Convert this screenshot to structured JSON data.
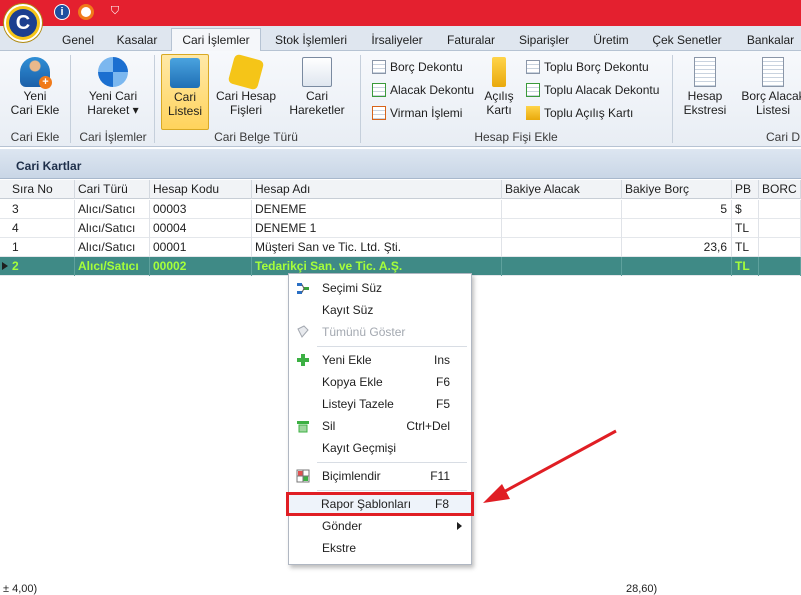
{
  "titlebar": {
    "logo_letter": "C",
    "info_glyph": "i"
  },
  "tabs": [
    {
      "label": "Genel",
      "active": false
    },
    {
      "label": "Kasalar",
      "active": false
    },
    {
      "label": "Cari İşlemler",
      "active": true
    },
    {
      "label": "Stok İşlemleri",
      "active": false
    },
    {
      "label": "İrsaliyeler",
      "active": false
    },
    {
      "label": "Faturalar",
      "active": false
    },
    {
      "label": "Siparişler",
      "active": false
    },
    {
      "label": "Üretim",
      "active": false
    },
    {
      "label": "Çek Senetler",
      "active": false
    },
    {
      "label": "Bankalar",
      "active": false
    }
  ],
  "ribbon": {
    "groups": {
      "cari_ekle": "Cari Ekle",
      "cari_islemler": "Cari İşlemler",
      "cari_belge_turu": "Cari Belge Türü",
      "hesap_fisi_ekle": "Hesap Fişi Ekle",
      "cari_d": "Cari D"
    },
    "buttons": {
      "yeni_cari_ekle": [
        "Yeni",
        "Cari Ekle"
      ],
      "yeni_cari_hareket": [
        "Yeni Cari",
        "Hareket"
      ],
      "cari_listesi": [
        "Cari",
        "Listesi"
      ],
      "cari_hesap_fisleri": [
        "Cari Hesap",
        "Fişleri"
      ],
      "cari_hareketler": [
        "Cari",
        "Hareketler"
      ],
      "acilis_karti": [
        "Açılış",
        "Kartı"
      ],
      "hesap_ekstresi": [
        "Hesap",
        "Ekstresi"
      ],
      "borc_alacak_listesi": [
        "Borç Alacak",
        "Listesi"
      ]
    },
    "small_buttons": {
      "borc_dekontu": "Borç Dekontu",
      "alacak_dekontu": "Alacak Dekontu",
      "virman_islemi": "Virman İşlemi",
      "toplu_borc_dekontu": "Toplu Borç Dekontu",
      "toplu_alacak_dekontu": "Toplu Alacak Dekontu",
      "toplu_acilis_karti": "Toplu Açılış Kartı"
    },
    "dropdown_caret": "▾"
  },
  "section": {
    "title": "Cari Kartlar"
  },
  "grid": {
    "columns": [
      "Sıra No",
      "Cari Türü",
      "Hesap Kodu",
      "Hesap Adı",
      "Bakiye Alacak",
      "Bakiye Borç",
      "PB",
      "BORC"
    ],
    "rows": [
      {
        "sira": "3",
        "tur": "Alıcı/Satıcı",
        "kod": "00003",
        "ad": "DENEME",
        "alacak": "",
        "borc": "5",
        "pb": "$",
        "borc2": "",
        "selected": false
      },
      {
        "sira": "4",
        "tur": "Alıcı/Satıcı",
        "kod": "00004",
        "ad": "DENEME 1",
        "alacak": "",
        "borc": "",
        "pb": "TL",
        "borc2": "",
        "selected": false
      },
      {
        "sira": "1",
        "tur": "Alıcı/Satıcı",
        "kod": "00001",
        "ad": "Müşteri San ve Tic. Ltd. Şti.",
        "alacak": "",
        "borc": "23,6",
        "pb": "TL",
        "borc2": "",
        "selected": false
      },
      {
        "sira": "2",
        "tur": "Alıcı/Satıcı",
        "kod": "00002",
        "ad": "Tedarikçi San. ve Tic. A.Ş.",
        "alacak": "",
        "borc": "",
        "pb": "TL",
        "borc2": "",
        "selected": true
      }
    ],
    "footer": {
      "left": "± 4,00)",
      "borc_total": "28,60)"
    }
  },
  "context_menu": {
    "items": [
      {
        "label": "Seçimi Süz",
        "key": "",
        "icon": "filter-selection-icon",
        "disabled": false
      },
      {
        "label": "Kayıt Süz",
        "key": "",
        "icon": "",
        "disabled": false
      },
      {
        "label": "Tümünü Göster",
        "key": "",
        "icon": "show-all-icon",
        "disabled": true
      },
      {
        "label": "Yeni Ekle",
        "key": "Ins",
        "icon": "plus-icon",
        "disabled": false
      },
      {
        "label": "Kopya Ekle",
        "key": "F6",
        "icon": "",
        "disabled": false
      },
      {
        "label": "Listeyi Tazele",
        "key": "F5",
        "icon": "",
        "disabled": false
      },
      {
        "label": "Sil",
        "key": "Ctrl+Del",
        "icon": "delete-icon",
        "disabled": false
      },
      {
        "label": "Kayıt Geçmişi",
        "key": "",
        "icon": "",
        "disabled": false
      },
      {
        "label": "Biçimlendir",
        "key": "F11",
        "icon": "format-grid-icon",
        "disabled": false
      },
      {
        "label": "Rapor Şablonları",
        "key": "F8",
        "icon": "",
        "disabled": false,
        "highlighted": true
      },
      {
        "label": "Gönder",
        "key": "",
        "icon": "",
        "disabled": false,
        "submenu": true
      },
      {
        "label": "Ekstre",
        "key": "",
        "icon": "",
        "disabled": false
      }
    ]
  },
  "colors": {
    "titlebar": "#e4202f",
    "selected_row_bg": "#3f8a86",
    "selected_row_text": "#a6ff3a",
    "annotation_red": "#e01e24",
    "ribbon_selected": "#ffd35c"
  }
}
